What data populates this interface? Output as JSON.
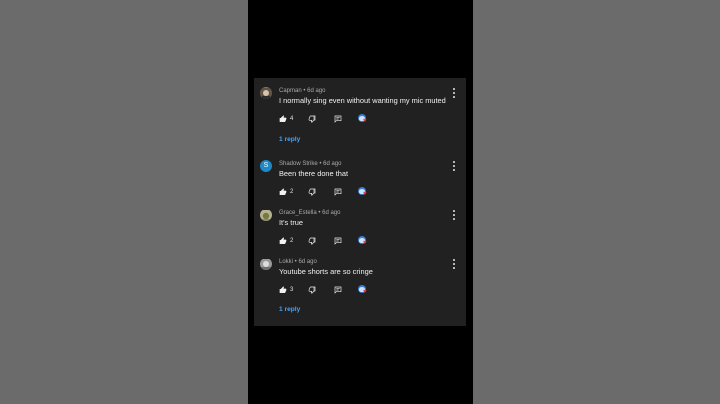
{
  "comments": [
    {
      "author": "Capman",
      "time": "6d ago",
      "text": "I normally sing even without wanting my mic muted",
      "likes": "4",
      "replies": "1 reply",
      "avatar": "photo-avatar"
    },
    {
      "author": "Shadow Strike",
      "time": "6d ago",
      "text": "Been there done that",
      "likes": "2",
      "avatar_letter": "S"
    },
    {
      "author": "Grace_Estella",
      "time": "6d ago",
      "text": "It's true",
      "likes": "2",
      "avatar": "photo-avatar"
    },
    {
      "author": "Lokki",
      "time": "6d ago",
      "text": "Youtube shorts are so cringe",
      "likes": "3",
      "replies": "1 reply",
      "avatar": "photo-avatar"
    }
  ],
  "meta_separator": " • ",
  "icons": [
    "thumbs-up-icon",
    "thumbs-down-icon",
    "reply-icon",
    "creator-heart-icon",
    "more-vert-icon"
  ],
  "colors": {
    "panel": "#212121",
    "link": "#3ea6ff",
    "heart": "#e53935",
    "avatar_s": "#1e88c8"
  }
}
